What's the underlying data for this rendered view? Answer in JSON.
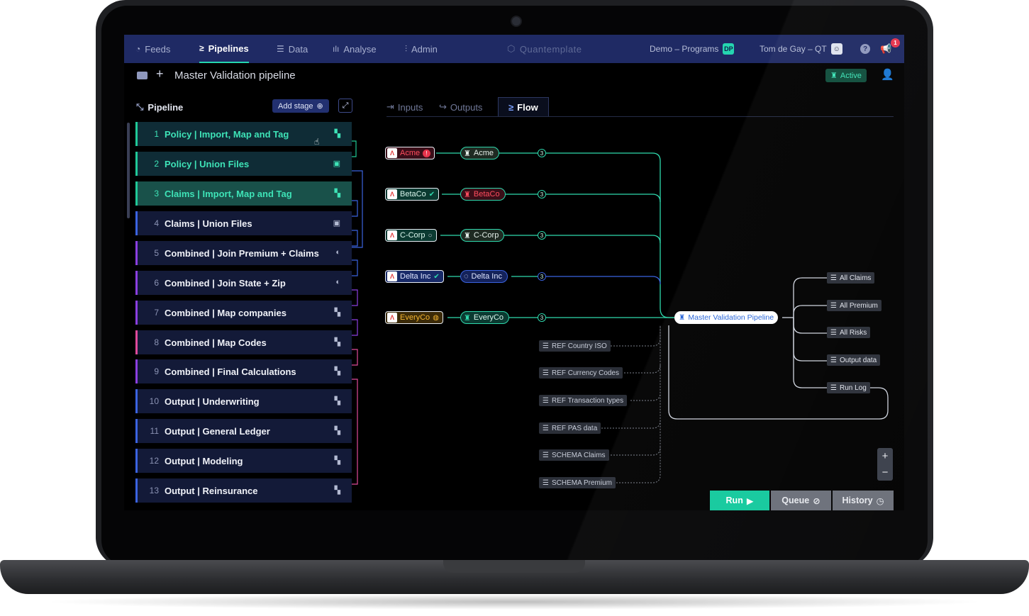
{
  "nav": {
    "items": [
      {
        "label": "Feeds",
        "icon": "feeds-icon"
      },
      {
        "label": "Pipelines",
        "icon": "pipelines-icon"
      },
      {
        "label": "Data",
        "icon": "data-icon"
      },
      {
        "label": "Analyse",
        "icon": "analyse-icon"
      },
      {
        "label": "Admin",
        "icon": "admin-icon"
      }
    ],
    "brand": "Quantemplate",
    "workspace": "Demo – Programs",
    "workspace_badge": "DP",
    "user": "Tom de Gay – QT",
    "notifications": "1"
  },
  "title_bar": {
    "title": "Master Validation pipeline",
    "status": "Active"
  },
  "pipeline": {
    "heading": "Pipeline",
    "add_stage": "Add stage",
    "stages": [
      {
        "num": "1",
        "label": "Policy | Import, Map and Tag"
      },
      {
        "num": "2",
        "label": "Policy | Union Files"
      },
      {
        "num": "3",
        "label": "Claims | Import, Map and Tag"
      },
      {
        "num": "4",
        "label": "Claims | Union Files"
      },
      {
        "num": "5",
        "label": "Combined | Join Premium + Claims"
      },
      {
        "num": "6",
        "label": "Combined | Join State + Zip"
      },
      {
        "num": "7",
        "label": "Combined | Map companies"
      },
      {
        "num": "8",
        "label": "Combined | Map Codes"
      },
      {
        "num": "9",
        "label": "Combined | Final Calculations"
      },
      {
        "num": "10",
        "label": "Output | Underwriting"
      },
      {
        "num": "11",
        "label": "Output | General Ledger"
      },
      {
        "num": "12",
        "label": "Output | Modeling"
      },
      {
        "num": "13",
        "label": "Output | Reinsurance"
      }
    ]
  },
  "tabs": {
    "inputs": "Inputs",
    "outputs": "Outputs",
    "flow": "Flow"
  },
  "flow": {
    "sources": [
      "Acme",
      "BetaCo",
      "C-Corp",
      "Delta Inc",
      "EveryCo"
    ],
    "middle": [
      "Acme",
      "BetaCo",
      "C-Corp",
      "Delta Inc",
      "EveryCo"
    ],
    "step_counts": [
      "3",
      "3",
      "3",
      "3",
      "3"
    ],
    "references": [
      "REF Country ISO",
      "REF Currency Codes",
      "REF Transaction types",
      "REF PAS data",
      "SCHEMA Claims",
      "SCHEMA Premium"
    ],
    "master": "Master Validation Pipeline",
    "outputs": [
      "All Claims",
      "All Premium",
      "All Risks",
      "Output data",
      "Run Log"
    ]
  },
  "actions": {
    "run": "Run",
    "queue": "Queue",
    "history": "History",
    "zoom_in": "+",
    "zoom_out": "−"
  },
  "colors": {
    "nav_bg": "#1f2a64",
    "teal": "#25d6b0",
    "error": "#e6344c",
    "accent_blue": "#3b63e0"
  }
}
